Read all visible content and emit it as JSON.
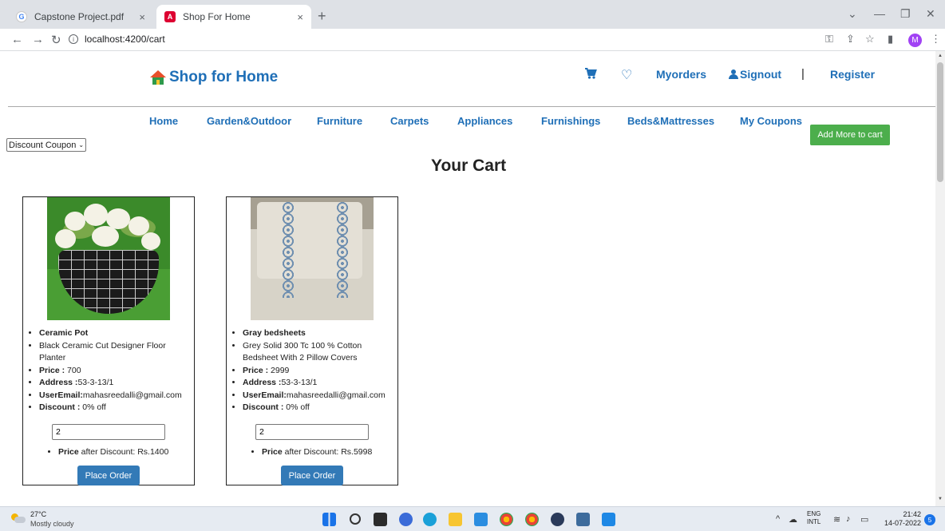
{
  "browser": {
    "tabs": [
      {
        "label": "Capstone Project.pdf",
        "favicon": "G"
      },
      {
        "label": "Shop For Home",
        "favicon": "A"
      }
    ],
    "tab_close": "×",
    "new_tab": "+",
    "url": "localhost:4200/cart",
    "profile_initial": "M"
  },
  "header": {
    "brand": "Shop for Home",
    "links": {
      "orders": "Myorders",
      "signout": "Signout",
      "register": "Register"
    },
    "separator": "|"
  },
  "nav": {
    "items": [
      "Home",
      "Garden&Outdoor",
      "Furniture",
      "Carpets",
      "Appliances",
      "Furnishings",
      "Beds&Mattresses",
      "My Coupons"
    ],
    "add_more": "Add More to cart"
  },
  "coupon_select": {
    "selected": "Discount Coupon"
  },
  "page_title": "Your Cart",
  "cart": [
    {
      "name": "Ceramic Pot",
      "description": "Black Ceramic Cut Designer Floor Planter",
      "price_label": "Price :",
      "price": " 700",
      "address_label": "Address :",
      "address": "53-3-13/1",
      "email_label": "UserEmail:",
      "email": "mahasreedalli@gmail.com",
      "discount_label": "Discount :",
      "discount": " 0% off",
      "quantity": "2",
      "after_label": "Price",
      "after_text": " after Discount: Rs.1400",
      "order_button": "Place Order"
    },
    {
      "name": "Gray bedsheets",
      "description": "Grey Solid 300 Tc 100 % Cotton Bedsheet With 2 Pillow Covers",
      "price_label": "Price :",
      "price": " 2999",
      "address_label": "Address :",
      "address": "53-3-13/1",
      "email_label": "UserEmail:",
      "email": "mahasreedalli@gmail.com",
      "discount_label": "Discount :",
      "discount": " 0% off",
      "quantity": "2",
      "after_label": "Price",
      "after_text": " after Discount: Rs.5998",
      "order_button": "Place Order"
    }
  ],
  "taskbar": {
    "temperature": "27°C",
    "weather": "Mostly cloudy",
    "lang_top": "ENG",
    "lang_bottom": "INTL",
    "time": "21:42",
    "date": "14-07-2022",
    "notifications": "5"
  },
  "colors": {
    "link": "#1f6fb7",
    "add_more": "#4cae4c",
    "order": "#337ab7"
  }
}
